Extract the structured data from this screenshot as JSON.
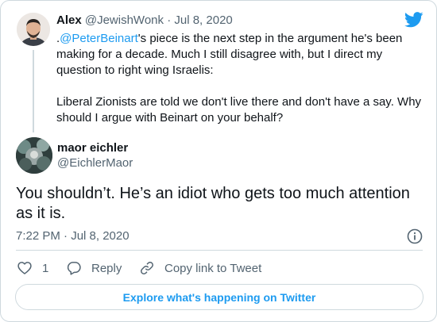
{
  "parent_tweet": {
    "name": "Alex",
    "handle": "@JewishWonk",
    "separator": "·",
    "date": "Jul 8, 2020",
    "text_prefix": ".",
    "mention": "@PeterBeinart",
    "text_line1_rest": "'s piece is the next step in the argument he's been making for a decade. Much I still disagree with, but I direct my question to right wing Israelis:",
    "text_paragraph2": "Liberal Zionists are told we don't live there and don't have a say. Why should I argue with Beinart on your behalf?"
  },
  "tweet": {
    "name": "maor eichler",
    "handle": "@EichlerMaor",
    "text": "You shouldn’t. He’s an idiot who gets too much attention as it is.",
    "timestamp": "7:22 PM · Jul 8, 2020"
  },
  "actions": {
    "like_count": "1",
    "reply_label": "Reply",
    "copy_label": "Copy link to Tweet"
  },
  "explore_label": "Explore what's happening on Twitter",
  "colors": {
    "accent": "#1d9bf0",
    "text": "#0f1419",
    "secondary": "#536471",
    "border": "#cfd9de"
  },
  "icons": [
    "twitter-bird-icon",
    "info-icon",
    "heart-icon",
    "reply-icon",
    "link-icon"
  ]
}
